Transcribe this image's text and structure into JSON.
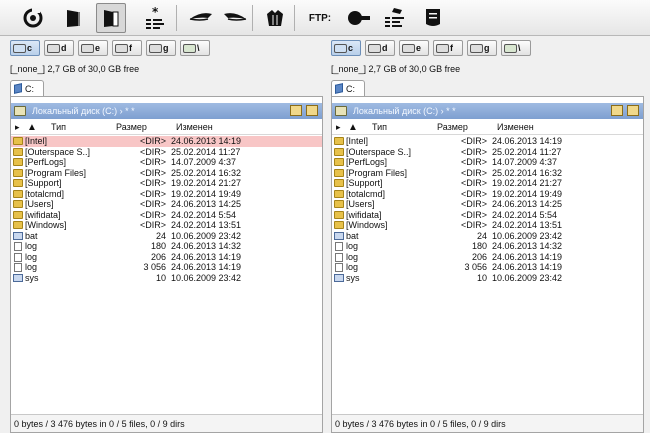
{
  "toolbar": {
    "ftp_label": "FTP:"
  },
  "panels": [
    {
      "drives": [
        {
          "letter": "c",
          "active": true
        },
        {
          "letter": "d",
          "active": false
        },
        {
          "letter": "e",
          "active": false
        },
        {
          "letter": "f",
          "active": false
        },
        {
          "letter": "g",
          "active": false
        },
        {
          "letter": "\\",
          "active": false
        }
      ],
      "free_info": "[_none_]  2,7 GB of 30,0 GB free",
      "tab_label": "C:",
      "path": "Локальный диск (C:) › * *",
      "columns": {
        "name": "Тип",
        "size": "Размер",
        "date": "Изменен"
      },
      "rows": [
        {
          "name": "[Intel]",
          "size": "<DIR>",
          "date": "24.06.2013 14:19",
          "type": "folder",
          "selected": true
        },
        {
          "name": "[Outerspace S..]",
          "size": "<DIR>",
          "date": "25.02.2014 11:27",
          "type": "folder"
        },
        {
          "name": "[PerfLogs]",
          "size": "<DIR>",
          "date": "14.07.2009 4:37",
          "type": "folder"
        },
        {
          "name": "[Program Files]",
          "size": "<DIR>",
          "date": "25.02.2014 16:32",
          "type": "folder"
        },
        {
          "name": "[Support]",
          "size": "<DIR>",
          "date": "19.02.2014 21:27",
          "type": "folder"
        },
        {
          "name": "[totalcmd]",
          "size": "<DIR>",
          "date": "19.02.2014 19:49",
          "type": "folder"
        },
        {
          "name": "[Users]",
          "size": "<DIR>",
          "date": "24.06.2013 14:25",
          "type": "folder"
        },
        {
          "name": "[wifidata]",
          "size": "<DIR>",
          "date": "24.02.2014 5:54",
          "type": "folder"
        },
        {
          "name": "[Windows]",
          "size": "<DIR>",
          "date": "24.02.2014 13:51",
          "type": "folder"
        },
        {
          "name": "bat",
          "size": "24",
          "date": "10.06.2009 23:42",
          "type": "exe"
        },
        {
          "name": "log",
          "size": "180",
          "date": "24.06.2013 14:32",
          "type": "file"
        },
        {
          "name": "log",
          "size": "206",
          "date": "24.06.2013 14:19",
          "type": "file"
        },
        {
          "name": "log",
          "size": "3 056",
          "date": "24.06.2013 14:19",
          "type": "file"
        },
        {
          "name": "sys",
          "size": "10",
          "date": "10.06.2009 23:42",
          "type": "exe"
        }
      ],
      "status": "0 bytes / 3 476 bytes in 0 / 5 files, 0 / 9 dirs"
    },
    {
      "drives": [
        {
          "letter": "c",
          "active": true
        },
        {
          "letter": "d",
          "active": false
        },
        {
          "letter": "e",
          "active": false
        },
        {
          "letter": "f",
          "active": false
        },
        {
          "letter": "g",
          "active": false
        },
        {
          "letter": "\\",
          "active": false
        }
      ],
      "free_info": "[_none_]  2,7 GB of 30,0 GB free",
      "tab_label": "C:",
      "path": "Локальный диск (C:) › * *",
      "columns": {
        "name": "Тип",
        "size": "Размер",
        "date": "Изменен"
      },
      "rows": [
        {
          "name": "[Intel]",
          "size": "<DIR>",
          "date": "24.06.2013 14:19",
          "type": "folder"
        },
        {
          "name": "[Outerspace S..]",
          "size": "<DIR>",
          "date": "25.02.2014 11:27",
          "type": "folder"
        },
        {
          "name": "[PerfLogs]",
          "size": "<DIR>",
          "date": "14.07.2009 4:37",
          "type": "folder"
        },
        {
          "name": "[Program Files]",
          "size": "<DIR>",
          "date": "25.02.2014 16:32",
          "type": "folder"
        },
        {
          "name": "[Support]",
          "size": "<DIR>",
          "date": "19.02.2014 21:27",
          "type": "folder"
        },
        {
          "name": "[totalcmd]",
          "size": "<DIR>",
          "date": "19.02.2014 19:49",
          "type": "folder"
        },
        {
          "name": "[Users]",
          "size": "<DIR>",
          "date": "24.06.2013 14:25",
          "type": "folder"
        },
        {
          "name": "[wifidata]",
          "size": "<DIR>",
          "date": "24.02.2014 5:54",
          "type": "folder"
        },
        {
          "name": "[Windows]",
          "size": "<DIR>",
          "date": "24.02.2014 13:51",
          "type": "folder"
        },
        {
          "name": "bat",
          "size": "24",
          "date": "10.06.2009 23:42",
          "type": "exe"
        },
        {
          "name": "log",
          "size": "180",
          "date": "24.06.2013 14:32",
          "type": "file"
        },
        {
          "name": "log",
          "size": "206",
          "date": "24.06.2013 14:19",
          "type": "file"
        },
        {
          "name": "log",
          "size": "3 056",
          "date": "24.06.2013 14:19",
          "type": "file"
        },
        {
          "name": "sys",
          "size": "10",
          "date": "10.06.2009 23:42",
          "type": "exe"
        }
      ],
      "status": "0 bytes / 3 476 bytes in 0 / 5 files, 0 / 9 dirs"
    }
  ]
}
